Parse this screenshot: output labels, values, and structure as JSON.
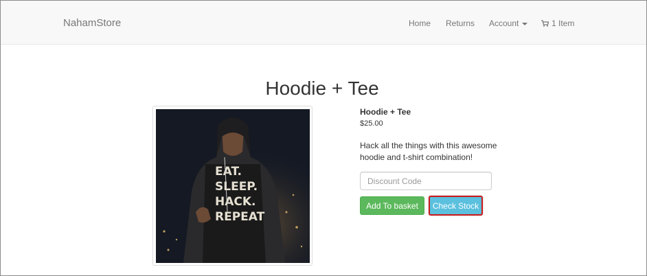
{
  "navbar": {
    "brand": "NahamStore",
    "links": {
      "home": "Home",
      "returns": "Returns",
      "account": "Account",
      "cart": "1 Item"
    }
  },
  "product": {
    "title": "Hoodie + Tee",
    "name": "Hoodie + Tee",
    "price": "$25.00",
    "description": "Hack all the things with this awesome hoodie and t-shirt combination!",
    "shirt_print": [
      "EAT.",
      "SLEEP.",
      "HACK.",
      "REPEAT"
    ]
  },
  "form": {
    "discount_placeholder": "Discount Code",
    "add_to_basket_label": "Add To basket",
    "check_stock_label": "Check Stock"
  },
  "colors": {
    "navbar_bg": "#f8f8f8",
    "success_button": "#5cb85c",
    "info_button": "#5bc0de",
    "highlight_border": "#cc1a1a"
  }
}
